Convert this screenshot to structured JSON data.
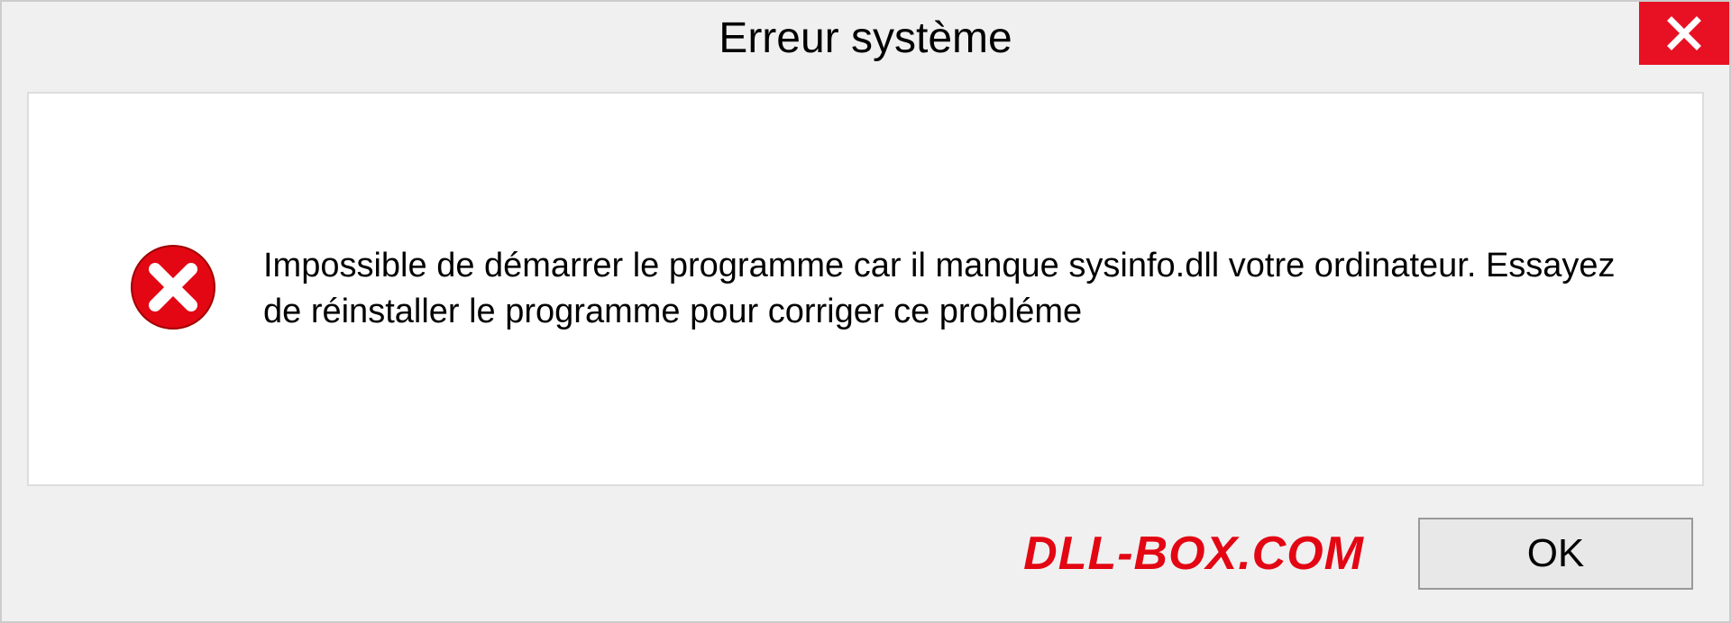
{
  "dialog": {
    "title": "Erreur système",
    "message": "Impossible de démarrer le programme car il manque sysinfo.dll votre ordinateur. Essayez de réinstaller le programme pour corriger ce probléme",
    "ok_label": "OK",
    "watermark": "DLL-BOX.COM"
  },
  "icons": {
    "close": "close-icon",
    "error": "error-circle-x-icon"
  },
  "colors": {
    "close_btn_bg": "#e81123",
    "error_icon": "#e30613",
    "watermark": "#e30613",
    "panel_bg": "#f0f0f0"
  }
}
